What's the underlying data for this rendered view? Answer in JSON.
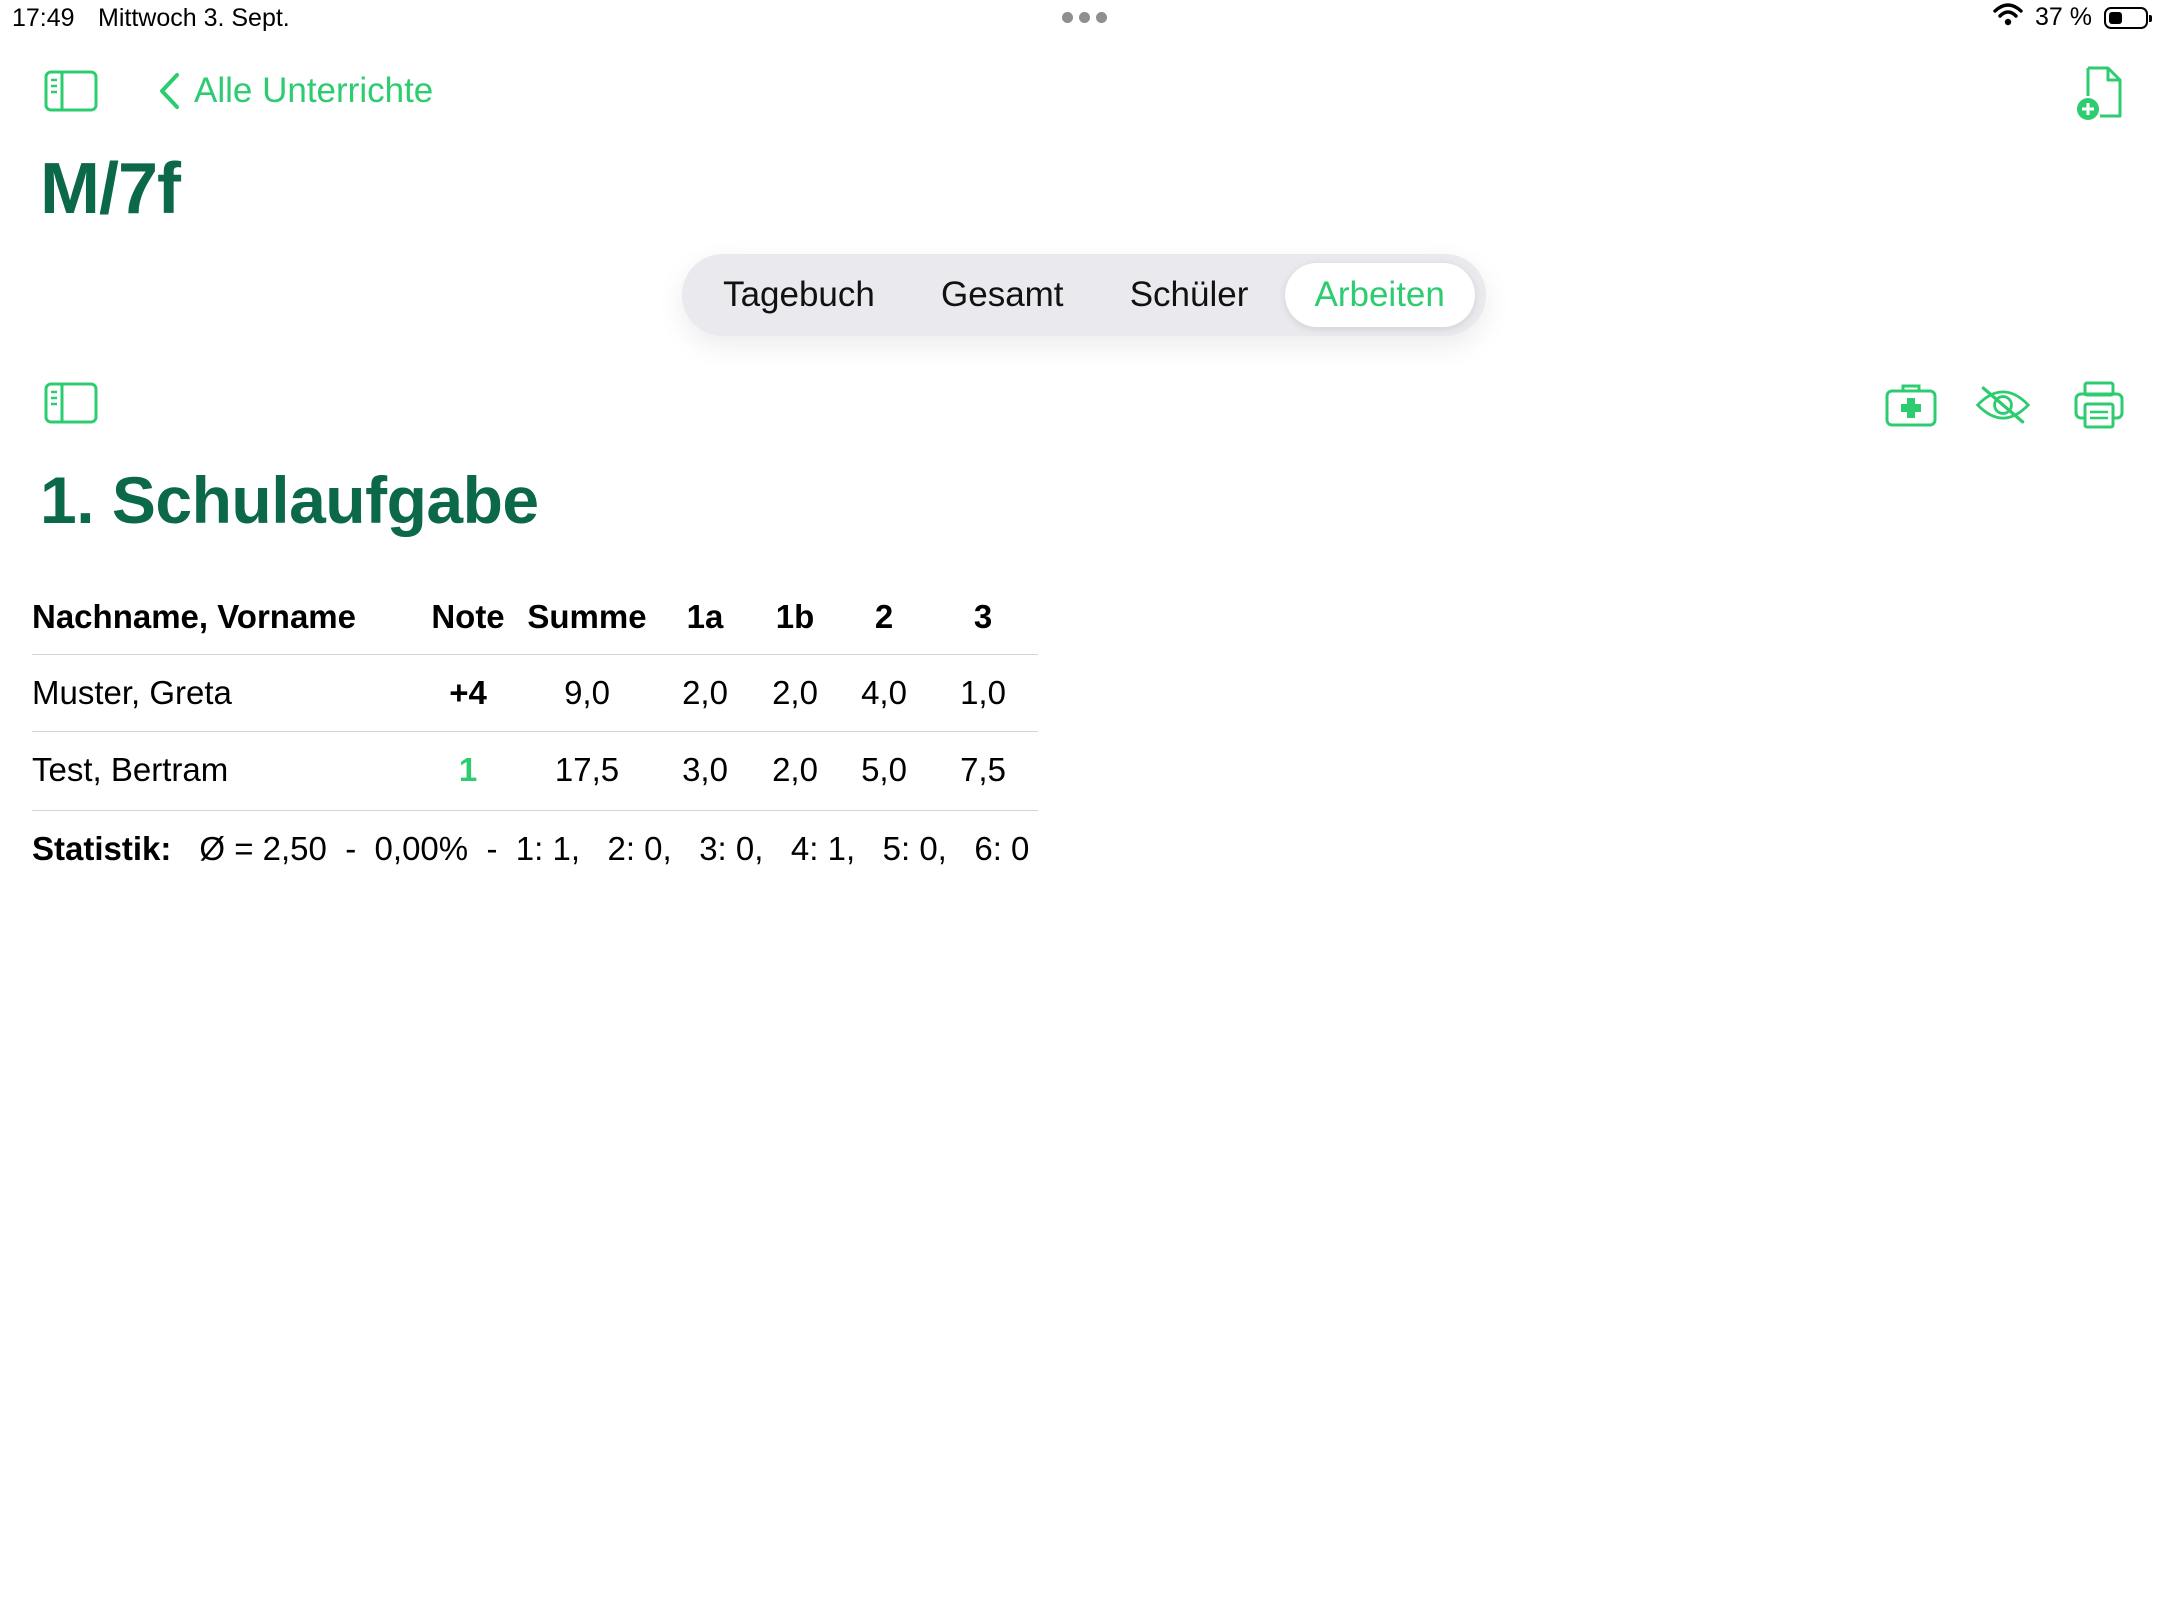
{
  "status_bar": {
    "time": "17:49",
    "date": "Mittwoch 3. Sept.",
    "battery_text": "37 %",
    "battery_level": 0.37
  },
  "nav": {
    "back_label": "Alle Unterrichte",
    "class_title": "M/7f"
  },
  "tabs": [
    {
      "label": "Tagebuch",
      "active": false
    },
    {
      "label": "Gesamt",
      "active": false
    },
    {
      "label": "Schüler",
      "active": false
    },
    {
      "label": "Arbeiten",
      "active": true
    }
  ],
  "exam": {
    "title": "1. Schulaufgabe",
    "columns": [
      "Nachname, Vorname",
      "Note",
      "Summe",
      "1a",
      "1b",
      "2",
      "3"
    ],
    "rows": [
      {
        "name": "Muster, Greta",
        "note": "+4",
        "summe": "9,0",
        "t1a": "2,0",
        "t1b": "2,0",
        "t2": "4,0",
        "t3": "1,0"
      },
      {
        "name": "Test, Bertram",
        "note": "1",
        "summe": "17,5",
        "t1a": "3,0",
        "t1b": "2,0",
        "t2": "5,0",
        "t3": "7,5"
      }
    ],
    "stats": {
      "label": "Statistik:",
      "text": "Ø = 2,50  -  0,00%  -  1: 1,   2: 0,   3: 0,   4: 1,   5: 0,   6: 0"
    }
  },
  "colors": {
    "accent": "#2ecc71",
    "title_green": "#0b6848",
    "segment_bg": "#e9e9ee"
  },
  "icons": {
    "wifi": "wifi-icon",
    "battery": "battery-icon",
    "sidebar": "sidebar-toggle-icon",
    "back": "chevron-left-icon",
    "new_doc": "document-add-icon",
    "first_aid": "first-aid-kit-icon",
    "hide": "eye-slash-icon",
    "print": "printer-icon"
  }
}
